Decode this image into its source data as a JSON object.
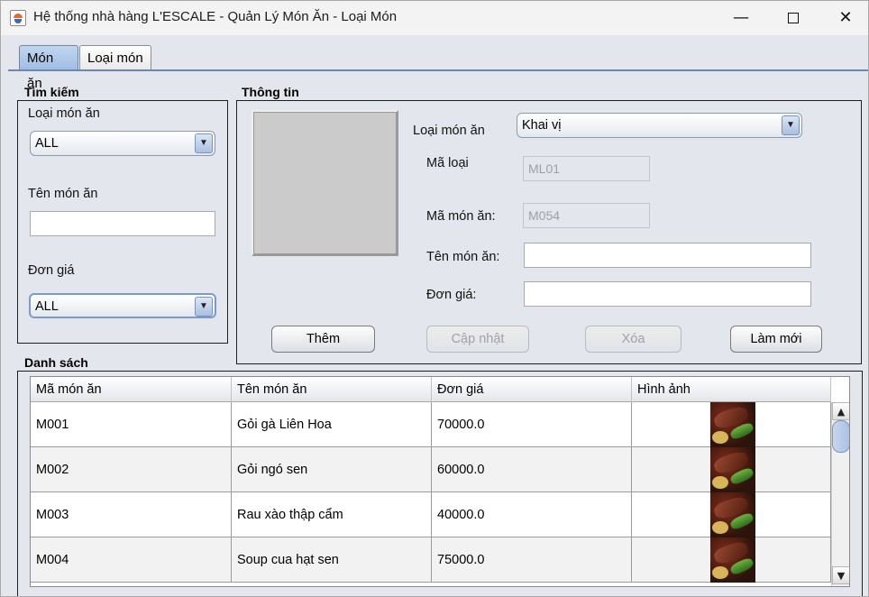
{
  "window": {
    "title": "Hệ thống nhà hàng L'ESCALE - Quản Lý Món Ăn - Loại Món",
    "minimize": "—",
    "close": "✕"
  },
  "tabs": [
    {
      "label": "Món ăn",
      "active": true
    },
    {
      "label": "Loại món",
      "active": false
    }
  ],
  "search": {
    "title": "Tìm kiếm",
    "category_label": "Loại món ăn",
    "category_value": "ALL",
    "name_label": "Tên món ăn",
    "name_value": "",
    "price_label": "Đơn giá",
    "price_value": "ALL"
  },
  "info": {
    "title": "Thông tin",
    "category_label": "Loại món ăn",
    "category_value": "Khai vị",
    "type_code_label": "Mã loại",
    "type_code_value": "ML01",
    "dish_code_label": "Mã món ăn:",
    "dish_code_value": "M054",
    "dish_name_label": "Tên món ăn:",
    "dish_name_value": "",
    "price_label": "Đơn giá:",
    "price_value": ""
  },
  "buttons": {
    "add": "Thêm",
    "update": "Cập nhật",
    "delete": "Xóa",
    "refresh": "Làm mới"
  },
  "list": {
    "title": "Danh sách",
    "columns": [
      "Mã món ăn",
      "Tên món ăn",
      "Đơn giá",
      "Hình ảnh"
    ],
    "rows": [
      {
        "code": "M001",
        "name": "Gỏi gà Liên Hoa",
        "price": "70000.0",
        "image": "steak-thumbnail"
      },
      {
        "code": "M002",
        "name": "Gỏi ngó sen",
        "price": "60000.0",
        "image": "steak-thumbnail"
      },
      {
        "code": "M003",
        "name": "Rau xào thập cẩm",
        "price": "40000.0",
        "image": "steak-thumbnail"
      },
      {
        "code": "M004",
        "name": "Soup cua hạt sen",
        "price": "75000.0",
        "image": "steak-thumbnail"
      }
    ]
  },
  "icons": {
    "dropdown": "chevron-down-icon",
    "scroll_up": "arrow-up-icon",
    "scroll_down": "arrow-down-icon"
  },
  "colors": {
    "window_bg": "#e3e6ec",
    "tab_active": "#9fbce4",
    "accent_border": "#6d88ad"
  }
}
